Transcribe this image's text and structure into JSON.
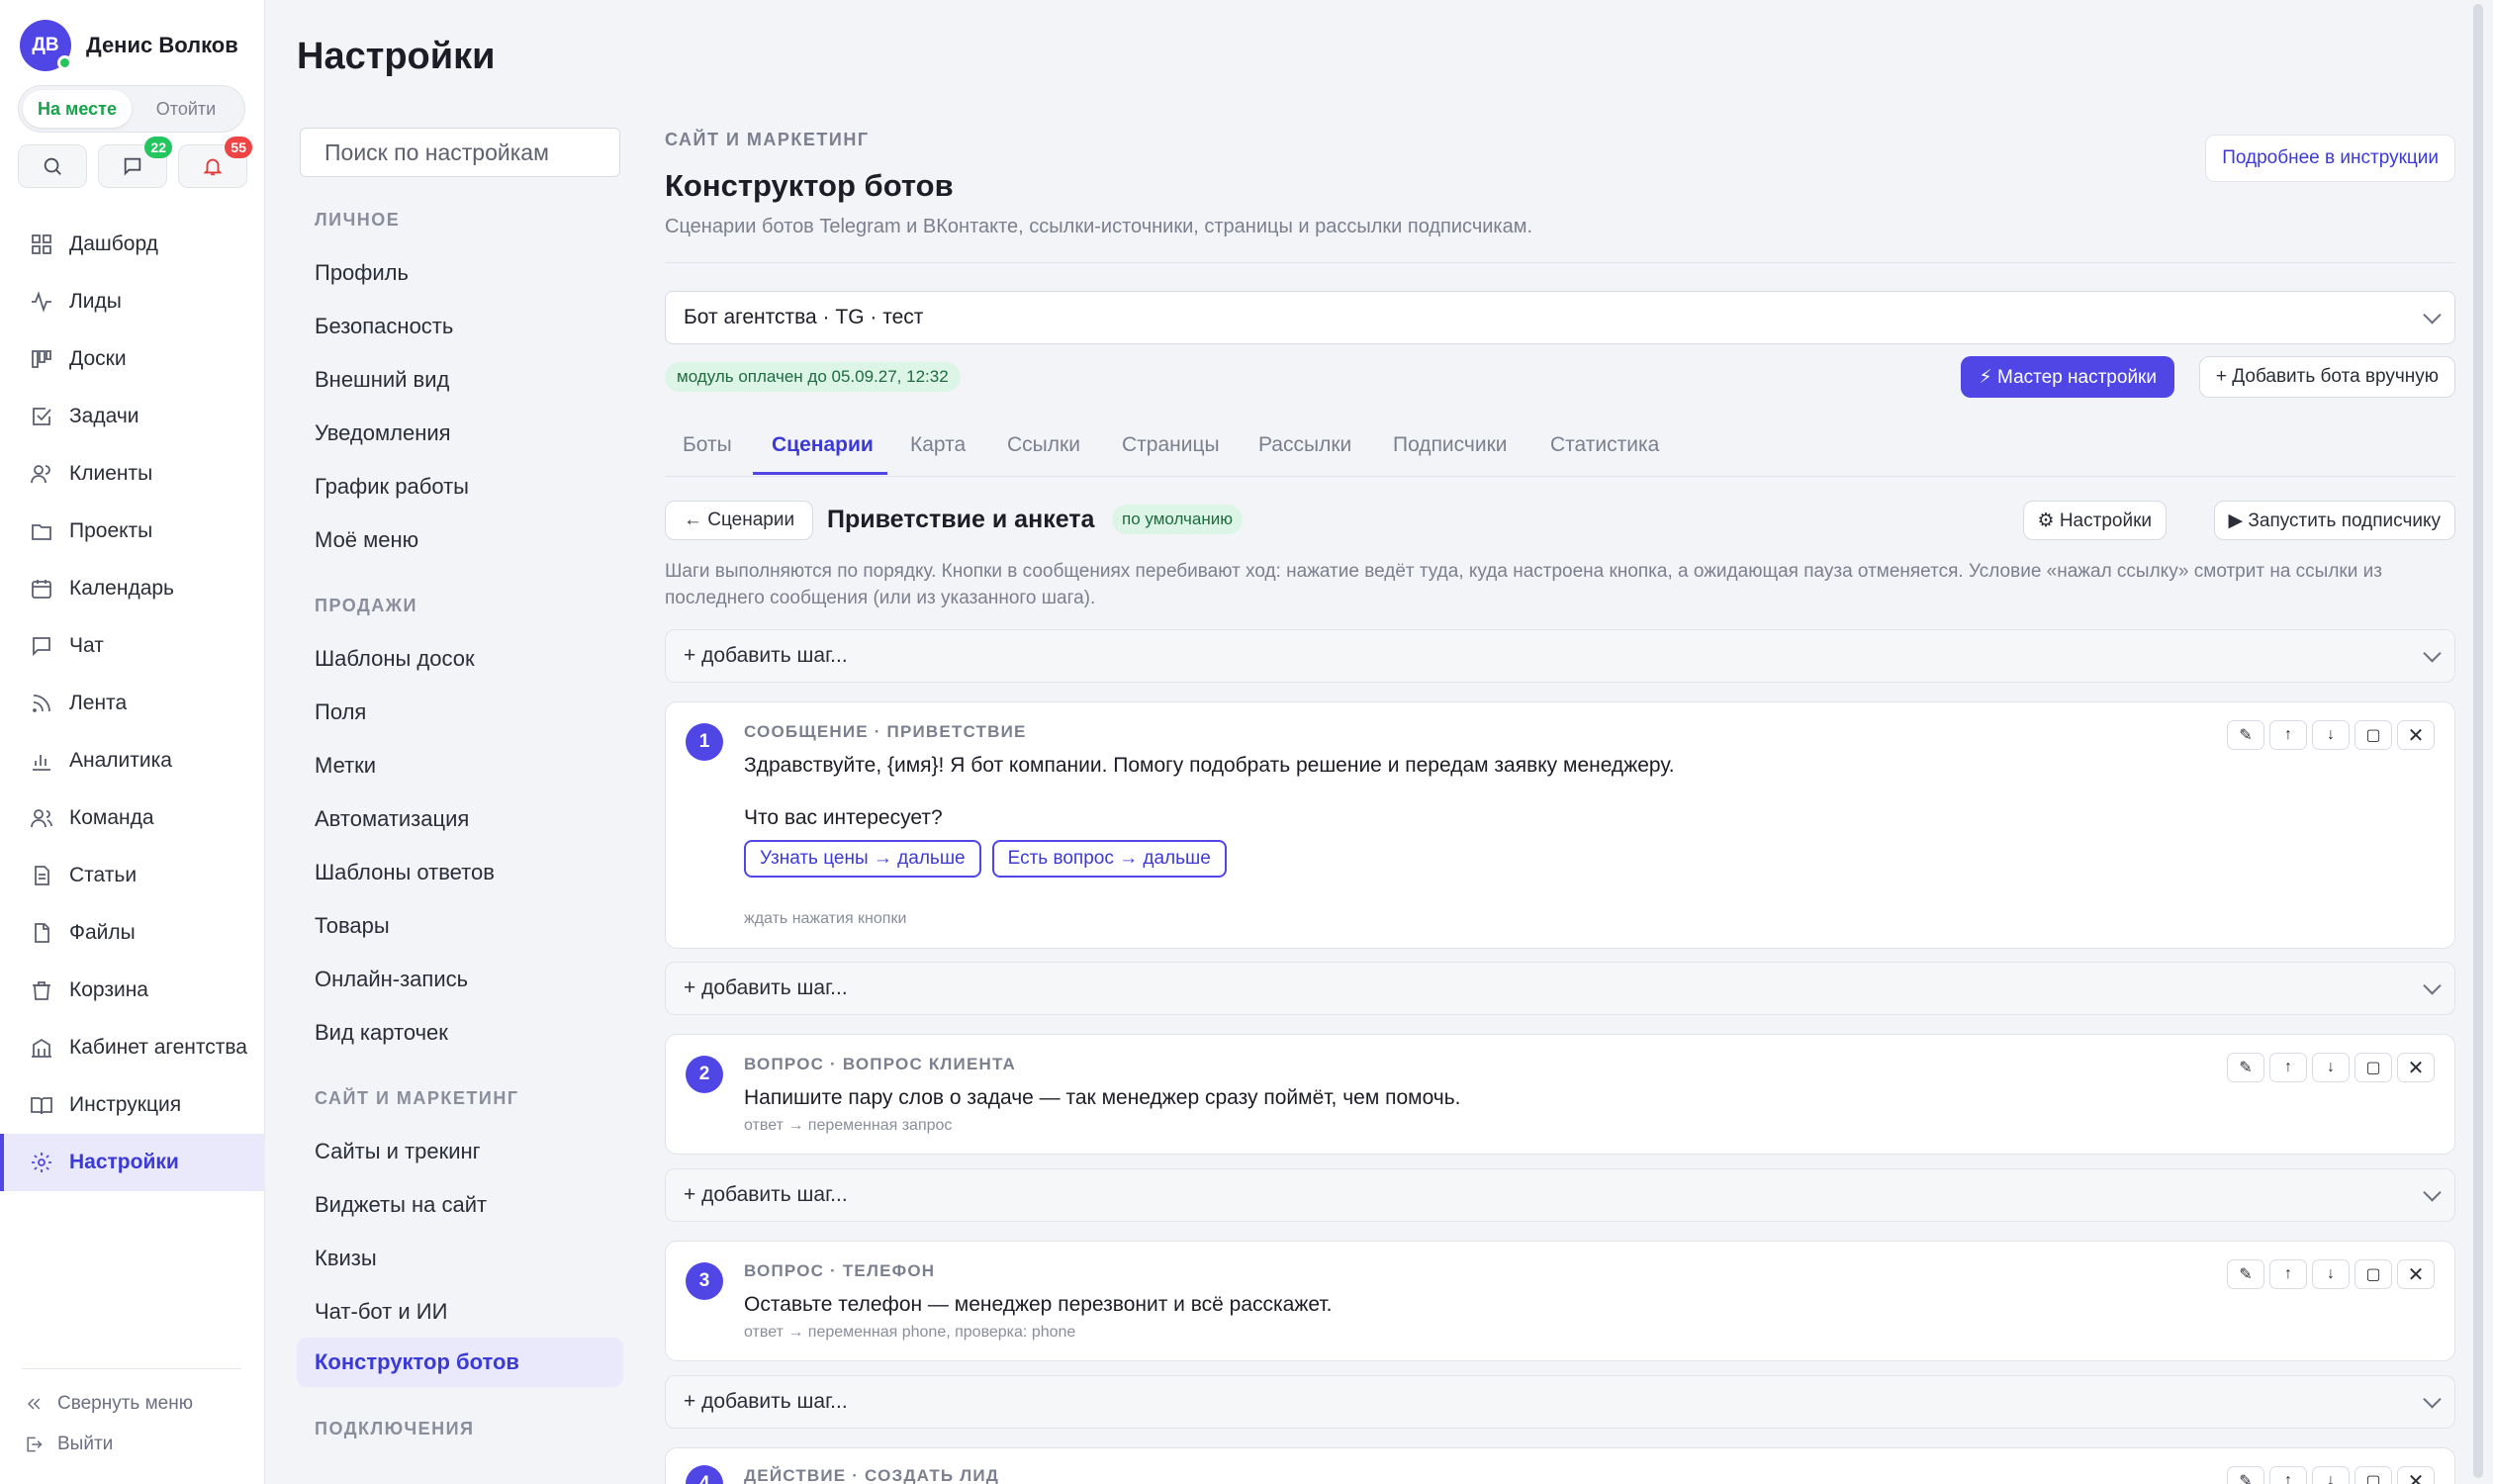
{
  "user": {
    "initials": "ДВ",
    "name": "Денис Волков",
    "status_on": "На месте",
    "status_off": "Отойти"
  },
  "quick": {
    "messages_count": "22",
    "alerts_count": "55"
  },
  "nav": [
    {
      "label": "Дашборд",
      "icon": "grid-icon"
    },
    {
      "label": "Лиды",
      "icon": "pulse-icon"
    },
    {
      "label": "Доски",
      "icon": "kanban-icon"
    },
    {
      "label": "Задачи",
      "icon": "checkbox-icon"
    },
    {
      "label": "Клиенты",
      "icon": "users-icon"
    },
    {
      "label": "Проекты",
      "icon": "folder-icon"
    },
    {
      "label": "Календарь",
      "icon": "calendar-icon"
    },
    {
      "label": "Чат",
      "icon": "chat-icon"
    },
    {
      "label": "Лента",
      "icon": "rss-icon"
    },
    {
      "label": "Аналитика",
      "icon": "bar-chart-icon"
    },
    {
      "label": "Команда",
      "icon": "team-icon"
    },
    {
      "label": "Статьи",
      "icon": "document-icon"
    },
    {
      "label": "Файлы",
      "icon": "file-icon"
    },
    {
      "label": "Корзина",
      "icon": "trash-icon"
    },
    {
      "label": "Кабинет агентства",
      "icon": "building-icon"
    },
    {
      "label": "Инструкция",
      "icon": "book-icon"
    },
    {
      "label": "Настройки",
      "icon": "gear-icon",
      "active": true
    }
  ],
  "sidebar_bottom": {
    "collapse": "Свернуть меню",
    "logout": "Выйти"
  },
  "page": {
    "title": "Настройки"
  },
  "settings_search": {
    "placeholder": "Поиск по настройкам"
  },
  "settings_nav": {
    "personal": {
      "title": "ЛИЧНОЕ",
      "items": [
        "Профиль",
        "Безопасность",
        "Внешний вид",
        "Уведомления",
        "График работы",
        "Моё меню"
      ]
    },
    "sales": {
      "title": "ПРОДАЖИ",
      "items": [
        "Шаблоны досок",
        "Поля",
        "Метки",
        "Автоматизация",
        "Шаблоны ответов",
        "Товары",
        "Онлайн-запись",
        "Вид карточек"
      ]
    },
    "marketing": {
      "title": "САЙТ И МАРКЕТИНГ",
      "items": [
        "Сайты и трекинг",
        "Виджеты на сайт",
        "Квизы",
        "Чат-бот и ИИ",
        "Конструктор ботов"
      ]
    },
    "connections": {
      "title": "ПОДКЛЮЧЕНИЯ"
    }
  },
  "section": {
    "kicker": "САЙТ И МАРКЕТИНГ",
    "title": "Конструктор ботов",
    "description": "Сценарии ботов Telegram и ВКонтакте, ссылки-источники, страницы и рассылки подписчикам.",
    "help_button": "Подробнее в инструкции"
  },
  "bot": {
    "selected": "Бот агентства · TG · тест",
    "paid_badge": "модуль оплачен до 05.09.27, 12:32",
    "wizard_button": "⚡ Мастер настройки",
    "add_manual_button": "+ Добавить бота вручную"
  },
  "tabs": [
    "Боты",
    "Сценарии",
    "Карта",
    "Ссылки",
    "Страницы",
    "Рассылки",
    "Подписчики",
    "Статистика"
  ],
  "active_tab": "Сценарии",
  "scenario": {
    "back_label": "← Сценарии",
    "title": "Приветствие и анкета",
    "badge": "по умолчанию",
    "settings_button": "⚙ Настройки",
    "run_button": "▶ Запустить подписчику",
    "hint": "Шаги выполняются по порядку. Кнопки в сообщениях перебивают ход: нажатие ведёт туда, куда настроена кнопка, а ожидающая пауза отменяется. Условие «нажал ссылку» смотрит на ссылки из последнего сообщения (или из указанного шага)."
  },
  "add_step_label": "+ добавить шаг...",
  "steps": [
    {
      "num": "1",
      "type": "СООБЩЕНИЕ · ПРИВЕТСТВИЕ",
      "text": "Здравствуйте, {имя}! Я бот компании. Помогу подобрать решение и передам заявку менеджеру.",
      "text2": "Что вас интересует?",
      "buttons": [
        "Узнать цены → дальше",
        "Есть вопрос → дальше"
      ],
      "note": "ждать нажатия кнопки"
    },
    {
      "num": "2",
      "type": "ВОПРОС · ВОПРОС КЛИЕНТА",
      "text": "Напишите пару слов о задаче — так менеджер сразу поймёт, чем помочь.",
      "note": "ответ → переменная запрос"
    },
    {
      "num": "3",
      "type": "ВОПРОС · ТЕЛЕФОН",
      "text": "Оставьте телефон — менеджер перезвонит и всё расскажет.",
      "note": "ответ → переменная phone, проверка: phone"
    },
    {
      "num": "4",
      "type": "ДЕЙСТВИЕ · СОЗДАТЬ ЛИД"
    }
  ],
  "step_tools": {
    "edit": "✎",
    "up": "↑",
    "down": "↓",
    "copy": "▢",
    "delete": "✕"
  }
}
